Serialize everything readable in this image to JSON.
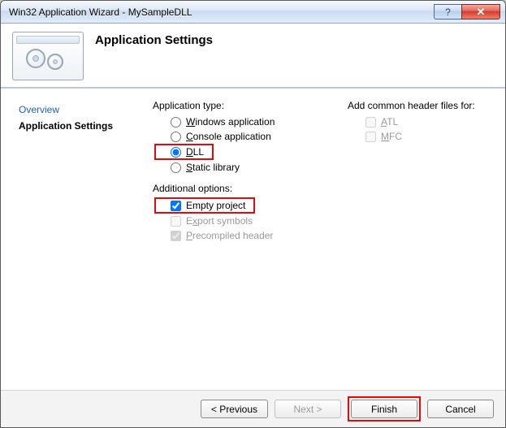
{
  "window": {
    "title": "Win32 Application Wizard - MySampleDLL"
  },
  "header": {
    "title": "Application Settings"
  },
  "sidebar": {
    "items": [
      {
        "label": "Overview",
        "active": false
      },
      {
        "label": "Application Settings",
        "active": true
      }
    ]
  },
  "content": {
    "app_type_label": "Application type:",
    "app_types": {
      "windows": "Windows application",
      "console": "Console application",
      "dll": "DLL",
      "static": "Static library"
    },
    "additional_label": "Additional options:",
    "additional": {
      "empty": "Empty project",
      "export": "Export symbols",
      "precompiled": "Precompiled header"
    },
    "common_header_label": "Add common header files for:",
    "common": {
      "atl": "ATL",
      "mfc": "MFC"
    }
  },
  "footer": {
    "previous": "< Previous",
    "next": "Next >",
    "finish": "Finish",
    "cancel": "Cancel"
  }
}
